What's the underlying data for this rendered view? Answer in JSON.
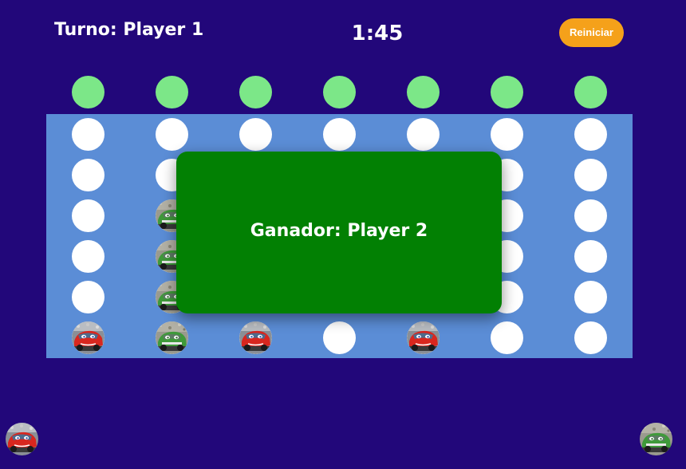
{
  "header": {
    "turn_text": "Turno: Player 1",
    "timer": "1:45",
    "restart_label": "Reiniciar"
  },
  "colors": {
    "background": "#22077a",
    "board": "#5b8dd6",
    "empty_cell": "#ffffff",
    "drop_slot": "#7ce788",
    "restart_button": "#f5a11a",
    "winner_modal": "#028003",
    "player1_piece": "red-car",
    "player2_piece": "green-car"
  },
  "board": {
    "columns": 7,
    "rows": 6,
    "cells": [
      [
        0,
        0,
        0,
        0,
        0,
        0,
        0
      ],
      [
        0,
        0,
        0,
        0,
        0,
        0,
        0
      ],
      [
        0,
        2,
        0,
        0,
        0,
        0,
        0
      ],
      [
        0,
        2,
        0,
        0,
        0,
        0,
        0
      ],
      [
        0,
        2,
        0,
        0,
        0,
        0,
        0
      ],
      [
        1,
        2,
        1,
        0,
        1,
        0,
        0
      ]
    ]
  },
  "modal": {
    "winner_text": "Ganador: Player 2"
  },
  "players": [
    {
      "icon": "red-car-icon"
    },
    {
      "icon": "green-car-icon"
    }
  ]
}
